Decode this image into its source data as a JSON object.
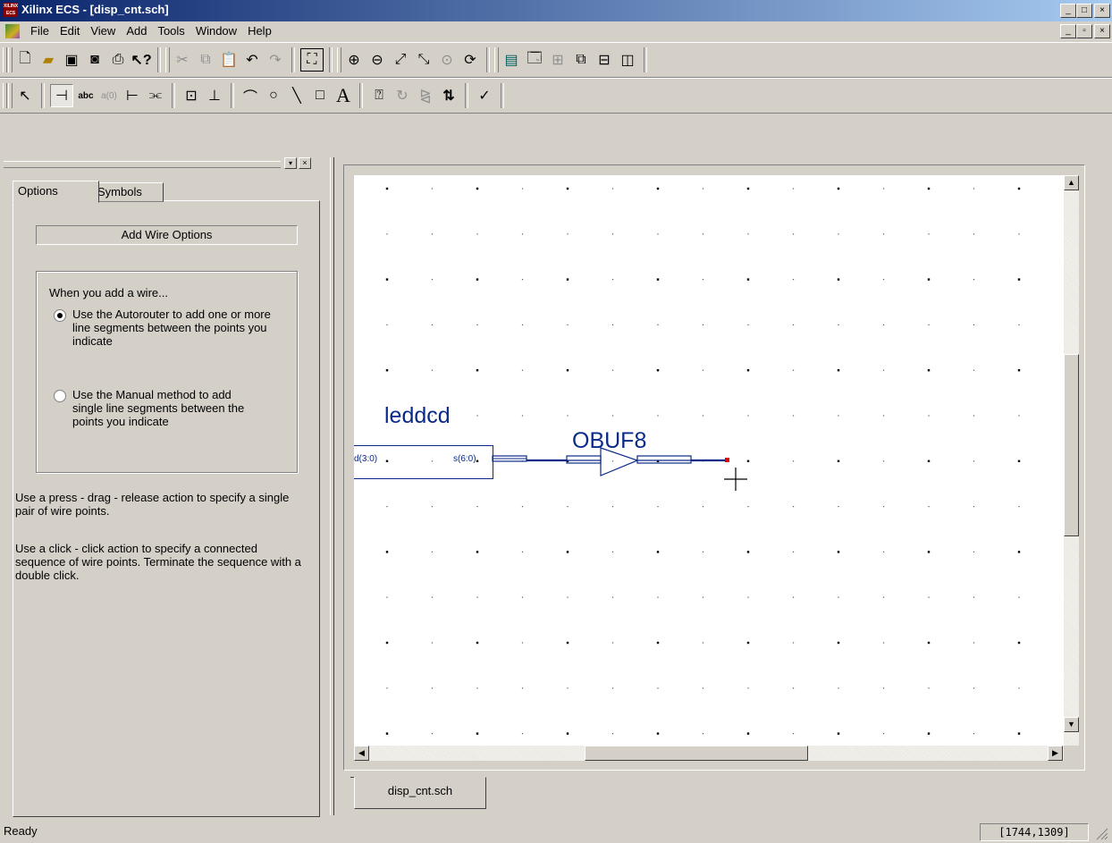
{
  "window": {
    "app_icon_text": "XILINX ECS",
    "title": "Xilinx ECS - [disp_cnt.sch]",
    "controls": {
      "minimize": "_",
      "maximize": "□",
      "close": "×"
    },
    "mdi_controls": {
      "minimize": "_",
      "restore": "▫",
      "close": "×"
    }
  },
  "menu": [
    "File",
    "Edit",
    "View",
    "Add",
    "Tools",
    "Window",
    "Help"
  ],
  "left_panel": {
    "tabs": [
      "Options",
      "Symbols"
    ],
    "active_tab": "Options",
    "header": "Add Wire Options",
    "group_label": "When you add a wire...",
    "options": [
      {
        "label": "Use the Autorouter to add one or more line segments between the points you indicate",
        "selected": true
      },
      {
        "label": "Use the Manual method to add single line segments between the points you indicate",
        "selected": false
      }
    ],
    "help_1": "Use a press - drag - release action to specify a single pair of wire points.",
    "help_2": "Use a click - click action to specify a connected sequence of wire points. Terminate the sequence with a double click."
  },
  "schematic": {
    "symbols": [
      {
        "name": "leddcd",
        "pins": [
          "d(3:0)",
          "s(6:0)"
        ]
      },
      {
        "name": "OBUF8"
      }
    ]
  },
  "document_tabs": [
    "disp_cnt.sch"
  ],
  "status": {
    "text": "Ready",
    "coords": "[1744,1309]"
  }
}
